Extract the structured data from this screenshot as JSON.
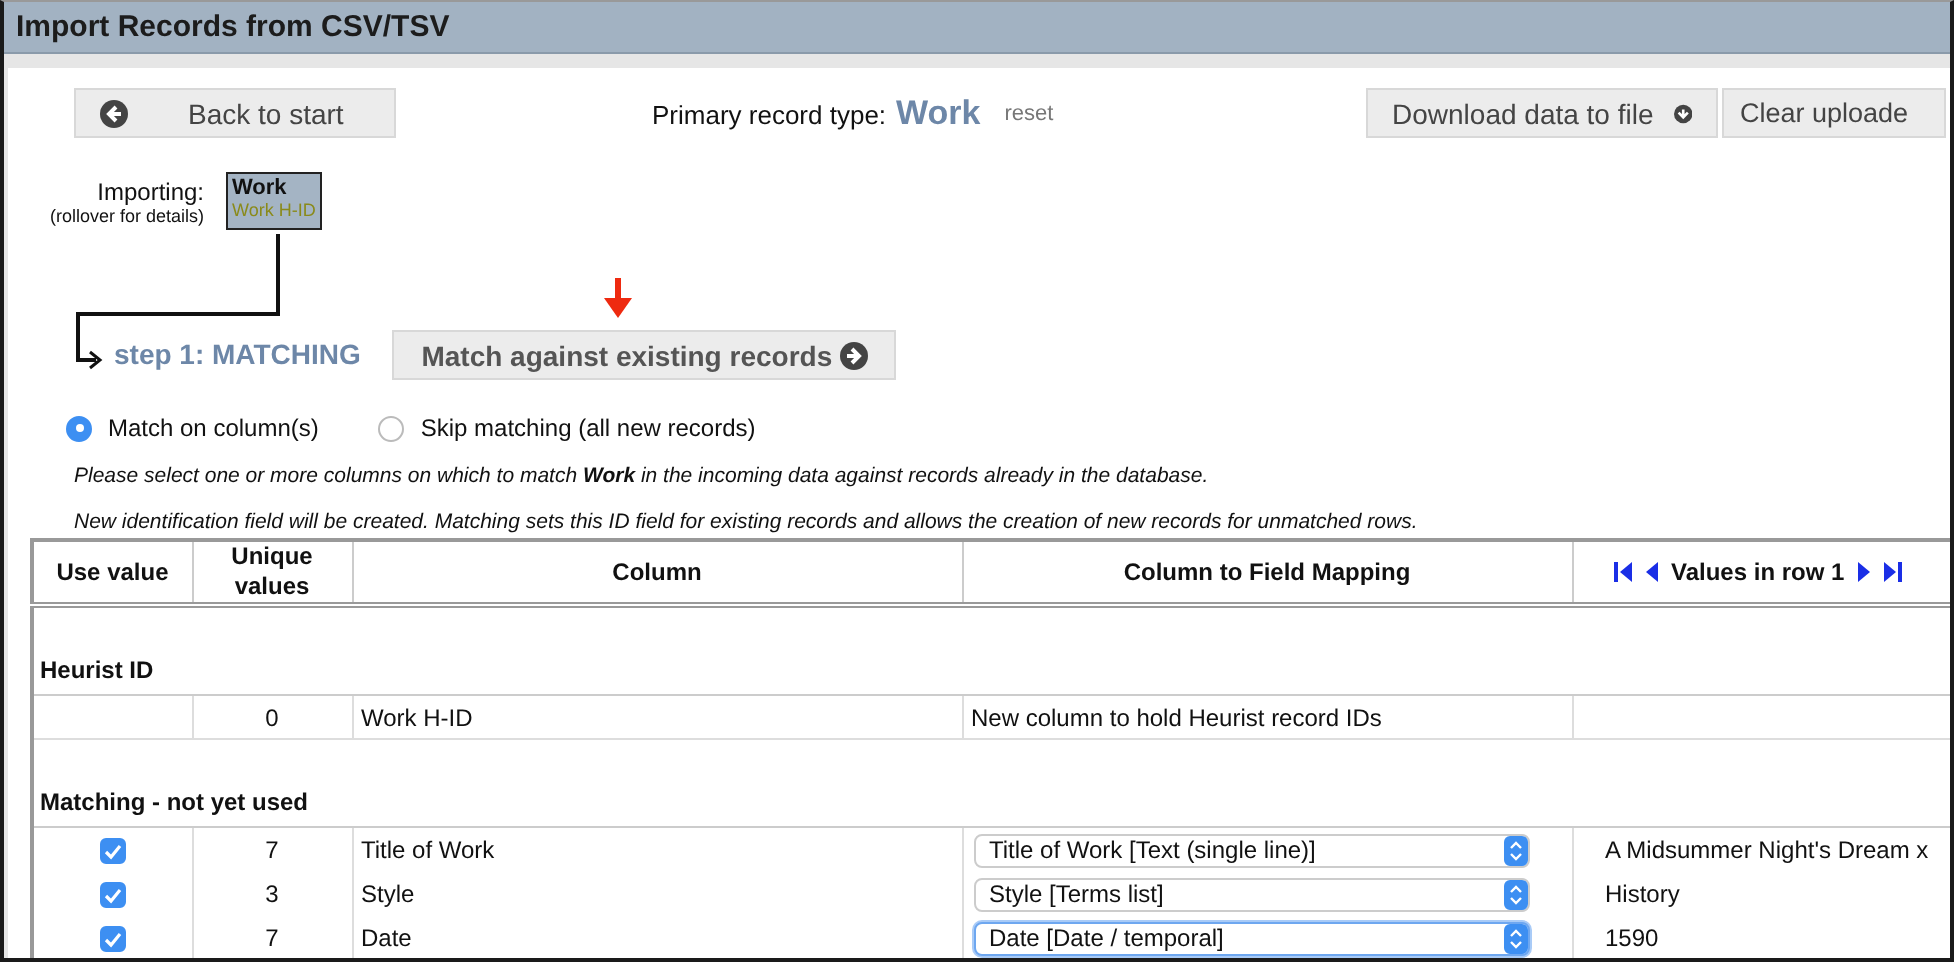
{
  "window": {
    "title": "Import Records from CSV/TSV"
  },
  "toolbar": {
    "back_button": "Back to start",
    "primary_label": "Primary record type:",
    "primary_type": "Work",
    "reset_link": "reset",
    "download_button": "Download data to file",
    "clear_button": "Clear uploade"
  },
  "importing": {
    "label": "Importing:",
    "hint": "(rollover for details)",
    "record_type": "Work",
    "id_field": "Work H-ID"
  },
  "step": {
    "label": "step 1: MATCHING",
    "button": "Match against existing records"
  },
  "match_options": [
    {
      "label": "Match on column(s)",
      "selected": true
    },
    {
      "label": "Skip matching (all new records)",
      "selected": false
    }
  ],
  "instructions": [
    "Please select one or more columns on which to match **Work** in the incoming data against records already in the database.",
    "New identification field will be created. Matching sets this ID field for existing records and allows the creation of new records for unmatched rows."
  ],
  "table": {
    "columns": [
      "Use value",
      "Unique values",
      "Column",
      "Column to Field Mapping"
    ],
    "values_header": "Values in row 1",
    "groups": [
      {
        "title": "Heurist ID",
        "rows": [
          {
            "kind": "id",
            "unique": "0",
            "column": "Work H-ID",
            "mapping": "New column to hold Heurist record IDs"
          }
        ]
      },
      {
        "title": "Matching - not yet used",
        "rows": [
          {
            "kind": "select",
            "checked": true,
            "unique": "7",
            "column": "Title of Work",
            "mapping": "Title of Work [Text (single line)]",
            "focused": false,
            "value": "A Midsummer Night's Dream x"
          },
          {
            "kind": "select",
            "checked": true,
            "unique": "3",
            "column": "Style",
            "mapping": "Style [Terms list]",
            "focused": false,
            "value": "History"
          },
          {
            "kind": "select",
            "checked": true,
            "unique": "7",
            "column": "Date",
            "mapping": "Date [Date / temporal]",
            "focused": true,
            "value": "1590"
          }
        ]
      }
    ]
  }
}
